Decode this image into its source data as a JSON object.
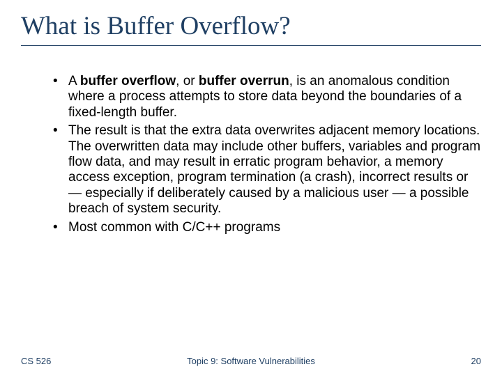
{
  "title": "What is Buffer Overflow?",
  "bullets": [
    {
      "pre": "A ",
      "bold1": "buffer overflow",
      "mid": ", or ",
      "bold2": "buffer overrun",
      "post": ", is an anomalous condition where a process attempts to store data beyond the boundaries of a fixed-length buffer."
    },
    {
      "text": "The result is that the extra data overwrites adjacent memory locations. The overwritten data may include other buffers, variables and program flow data, and may result in erratic program behavior, a memory access exception, program termination (a crash), incorrect results or — especially if deliberately caused by a malicious user — a possible breach of system security."
    },
    {
      "text": "Most common with C/C++ programs"
    }
  ],
  "footer": {
    "left": "CS 526",
    "center": "Topic 9: Software Vulnerabilities",
    "right": "20"
  }
}
